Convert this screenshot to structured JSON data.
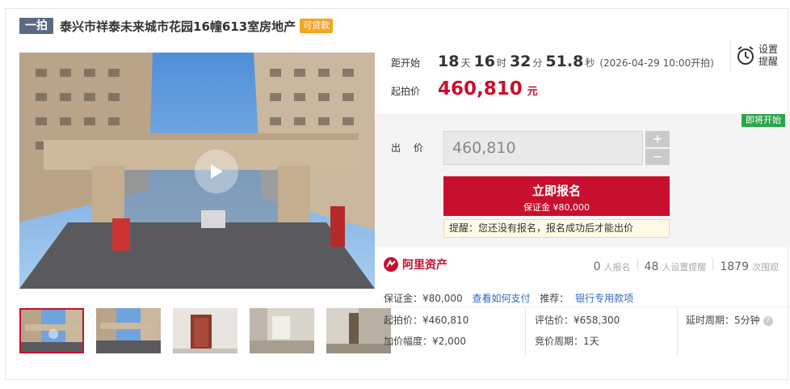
{
  "header": {
    "round_badge": "一拍",
    "title": "泰兴市祥泰未来城市花园16幢613室房地产",
    "loan_badge": "可贷款"
  },
  "countdown": {
    "label": "距开始",
    "days": "18",
    "days_unit": "天",
    "hours": "16",
    "hours_unit": "时",
    "minutes": "32",
    "minutes_unit": "分",
    "seconds": "51.8",
    "seconds_unit": "秒",
    "start_time": "(2026-04-29 10:00开拍)"
  },
  "remind": {
    "label": "设置提醒"
  },
  "start_price": {
    "label": "起拍价",
    "value": "460,810",
    "unit": "元"
  },
  "bid": {
    "status_badge": "即将开始",
    "label": "出 价",
    "value": "460,810",
    "plus": "+",
    "minus": "−",
    "signup_main": "立即报名",
    "signup_sub": "保证金 ¥80,000",
    "tip": "提醒：您还没有报名，报名成功后才能出价"
  },
  "stats": {
    "logo_text": "阿里资产",
    "signups_num": "0",
    "signups_label": "人报名",
    "reminders_num": "48",
    "reminders_label": "人设置提醒",
    "views_num": "1879",
    "views_label": "次围观"
  },
  "info": {
    "deposit": "保证金：¥80,000",
    "how_to_pay": "查看如何支付",
    "recommend": "推荐：",
    "bank_loan": "银行专用款项",
    "start_price": "起拍价：¥460,810",
    "appraisal": "评估价：¥658,300",
    "delay": "延时周期：5分钟",
    "increment": "加价幅度：¥2,000",
    "cycle": "竞价周期：1天"
  },
  "colors": {
    "accent": "#c8102e",
    "status_green": "#2aa64a",
    "link": "#2f6cbf",
    "badge_orange": "#f5a623"
  }
}
